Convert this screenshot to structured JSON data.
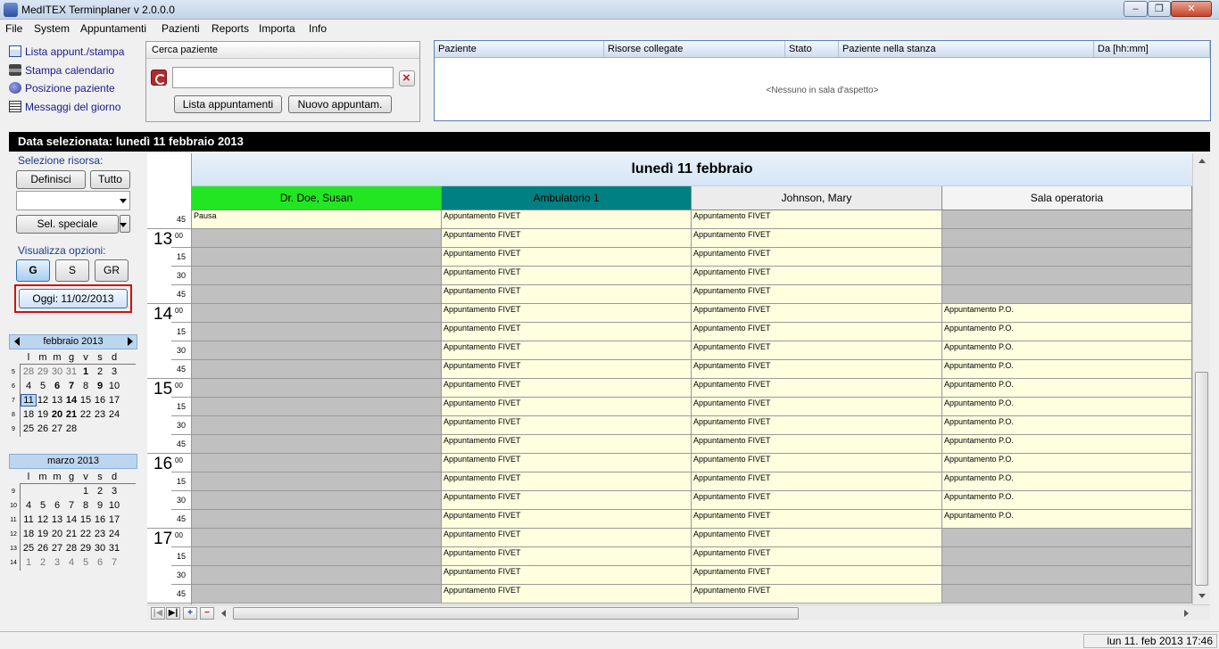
{
  "window": {
    "title": "MedITEX  Terminplaner v 2.0.0.0",
    "min_icon": "minimize-icon",
    "max_icon": "maximize-icon",
    "close_icon": "close-icon"
  },
  "menu": [
    "File",
    "System",
    "Appuntamenti",
    "Pazienti",
    "Reports",
    "Importa",
    "Info"
  ],
  "quick_links": [
    {
      "label": "Lista appunt./stampa",
      "icon": "list-icon"
    },
    {
      "label": "Stampa calendario",
      "icon": "printer-icon"
    },
    {
      "label": "Posizione paziente",
      "icon": "patient-position-icon"
    },
    {
      "label": "Messaggi del giorno",
      "icon": "messages-icon"
    }
  ],
  "search": {
    "title": "Cerca paziente",
    "value": "",
    "btn_list": "Lista appuntamenti",
    "btn_new": "Nuovo appuntam."
  },
  "waiting_room": {
    "columns": [
      "Paziente",
      "Risorse collegate",
      "Stato",
      "Paziente nella stanza",
      "Da [hh:mm]"
    ],
    "empty": "<Nessuno in sala d'aspetto>"
  },
  "selected_date": "Data selezionata: lunedì 11 febbraio 2013",
  "left": {
    "resource_label": "Selezione risorsa:",
    "btn_define": "Definisci",
    "btn_all": "Tutto",
    "dropdown_value": "",
    "btn_special": "Sel. speciale",
    "view_label": "Visualizza opzioni:",
    "view_options": [
      "G",
      "S",
      "GR"
    ],
    "today_button": "Oggi: 11/02/2013"
  },
  "calendars": [
    {
      "title": "febbraio 2013",
      "weekdays": [
        "l",
        "m",
        "m",
        "g",
        "v",
        "s",
        "d"
      ],
      "weeks": [
        {
          "wk": "5",
          "days": [
            {
              "d": "28",
              "o": 1
            },
            {
              "d": "29",
              "o": 1
            },
            {
              "d": "30",
              "o": 1
            },
            {
              "d": "31",
              "o": 1
            },
            {
              "d": "1",
              "b": 1
            },
            {
              "d": "2"
            },
            {
              "d": "3"
            }
          ]
        },
        {
          "wk": "6",
          "days": [
            {
              "d": "4"
            },
            {
              "d": "5"
            },
            {
              "d": "6",
              "b": 1
            },
            {
              "d": "7",
              "b": 1
            },
            {
              "d": "8"
            },
            {
              "d": "9",
              "b": 1
            },
            {
              "d": "10"
            }
          ]
        },
        {
          "wk": "7",
          "days": [
            {
              "d": "11",
              "t": 1
            },
            {
              "d": "12"
            },
            {
              "d": "13"
            },
            {
              "d": "14",
              "b": 1
            },
            {
              "d": "15"
            },
            {
              "d": "16"
            },
            {
              "d": "17"
            }
          ]
        },
        {
          "wk": "8",
          "days": [
            {
              "d": "18"
            },
            {
              "d": "19"
            },
            {
              "d": "20",
              "b": 1
            },
            {
              "d": "21",
              "b": 1
            },
            {
              "d": "22"
            },
            {
              "d": "23"
            },
            {
              "d": "24"
            }
          ]
        },
        {
          "wk": "9",
          "days": [
            {
              "d": "25"
            },
            {
              "d": "26"
            },
            {
              "d": "27"
            },
            {
              "d": "28"
            }
          ]
        }
      ]
    },
    {
      "title": "marzo 2013",
      "weekdays": [
        "l",
        "m",
        "m",
        "g",
        "v",
        "s",
        "d"
      ],
      "weeks": [
        {
          "wk": "9",
          "days": [
            {
              "d": ""
            },
            {
              "d": ""
            },
            {
              "d": ""
            },
            {
              "d": ""
            },
            {
              "d": "1"
            },
            {
              "d": "2"
            },
            {
              "d": "3"
            }
          ]
        },
        {
          "wk": "10",
          "days": [
            {
              "d": "4"
            },
            {
              "d": "5"
            },
            {
              "d": "6"
            },
            {
              "d": "7"
            },
            {
              "d": "8"
            },
            {
              "d": "9"
            },
            {
              "d": "10"
            }
          ]
        },
        {
          "wk": "11",
          "days": [
            {
              "d": "11"
            },
            {
              "d": "12"
            },
            {
              "d": "13"
            },
            {
              "d": "14"
            },
            {
              "d": "15"
            },
            {
              "d": "16"
            },
            {
              "d": "17"
            }
          ]
        },
        {
          "wk": "12",
          "days": [
            {
              "d": "18"
            },
            {
              "d": "19"
            },
            {
              "d": "20"
            },
            {
              "d": "21"
            },
            {
              "d": "22"
            },
            {
              "d": "23"
            },
            {
              "d": "24"
            }
          ]
        },
        {
          "wk": "13",
          "days": [
            {
              "d": "25"
            },
            {
              "d": "26"
            },
            {
              "d": "27"
            },
            {
              "d": "28"
            },
            {
              "d": "29"
            },
            {
              "d": "30"
            },
            {
              "d": "31"
            }
          ]
        },
        {
          "wk": "14",
          "days": [
            {
              "d": "1",
              "o": 1
            },
            {
              "d": "2",
              "o": 1
            },
            {
              "d": "3",
              "o": 1
            },
            {
              "d": "4",
              "o": 1
            },
            {
              "d": "5",
              "o": 1
            },
            {
              "d": "6",
              "o": 1
            },
            {
              "d": "7",
              "o": 1
            }
          ]
        }
      ]
    }
  ],
  "schedule": {
    "day_title": "lunedì 11 febbraio",
    "resources": [
      {
        "name": "Dr. Doe, Susan",
        "color": "#22e622"
      },
      {
        "name": "Ambulatorio 1",
        "color": "#008080"
      },
      {
        "name": "Johnson, Mary",
        "color": "#ececec"
      },
      {
        "name": "Sala operatoria",
        "color": "#f4f4f4"
      }
    ],
    "times": [
      {
        "h": "",
        "m": "45"
      },
      {
        "h": "13",
        "m": "00"
      },
      {
        "h": "",
        "m": "15"
      },
      {
        "h": "",
        "m": "30"
      },
      {
        "h": "",
        "m": "45"
      },
      {
        "h": "14",
        "m": "00"
      },
      {
        "h": "",
        "m": "15"
      },
      {
        "h": "",
        "m": "30"
      },
      {
        "h": "",
        "m": "45"
      },
      {
        "h": "15",
        "m": "00"
      },
      {
        "h": "",
        "m": "15"
      },
      {
        "h": "",
        "m": "30"
      },
      {
        "h": "",
        "m": "45"
      },
      {
        "h": "16",
        "m": "00"
      },
      {
        "h": "",
        "m": "15"
      },
      {
        "h": "",
        "m": "30"
      },
      {
        "h": "",
        "m": "45"
      },
      {
        "h": "17",
        "m": "00"
      },
      {
        "h": "",
        "m": "15"
      },
      {
        "h": "",
        "m": "30"
      },
      {
        "h": "",
        "m": "45"
      }
    ],
    "rows": [
      [
        "Pausa",
        "Appuntamento FIVET",
        "Appuntamento FIVET",
        null
      ],
      [
        null,
        "Appuntamento FIVET",
        "Appuntamento FIVET",
        null
      ],
      [
        null,
        "Appuntamento FIVET",
        "Appuntamento FIVET",
        null
      ],
      [
        null,
        "Appuntamento FIVET",
        "Appuntamento FIVET",
        null
      ],
      [
        null,
        "Appuntamento FIVET",
        "Appuntamento FIVET",
        null
      ],
      [
        null,
        "Appuntamento FIVET",
        "Appuntamento FIVET",
        "Appuntamento P.O."
      ],
      [
        null,
        "Appuntamento FIVET",
        "Appuntamento FIVET",
        "Appuntamento P.O."
      ],
      [
        null,
        "Appuntamento FIVET",
        "Appuntamento FIVET",
        "Appuntamento P.O."
      ],
      [
        null,
        "Appuntamento FIVET",
        "Appuntamento FIVET",
        "Appuntamento P.O."
      ],
      [
        null,
        "Appuntamento FIVET",
        "Appuntamento FIVET",
        "Appuntamento P.O."
      ],
      [
        null,
        "Appuntamento FIVET",
        "Appuntamento FIVET",
        "Appuntamento P.O."
      ],
      [
        null,
        "Appuntamento FIVET",
        "Appuntamento FIVET",
        "Appuntamento P.O."
      ],
      [
        null,
        "Appuntamento FIVET",
        "Appuntamento FIVET",
        "Appuntamento P.O."
      ],
      [
        null,
        "Appuntamento FIVET",
        "Appuntamento FIVET",
        "Appuntamento P.O."
      ],
      [
        null,
        "Appuntamento FIVET",
        "Appuntamento FIVET",
        "Appuntamento P.O."
      ],
      [
        null,
        "Appuntamento FIVET",
        "Appuntamento FIVET",
        "Appuntamento P.O."
      ],
      [
        null,
        "Appuntamento FIVET",
        "Appuntamento FIVET",
        "Appuntamento P.O."
      ],
      [
        null,
        "Appuntamento FIVET",
        "Appuntamento FIVET",
        null
      ],
      [
        null,
        "Appuntamento FIVET",
        "Appuntamento FIVET",
        null
      ],
      [
        null,
        "Appuntamento FIVET",
        "Appuntamento FIVET",
        null
      ],
      [
        null,
        "Appuntamento FIVET",
        "Appuntamento FIVET",
        null
      ]
    ]
  },
  "status_time": "lun 11. feb 2013 17:46"
}
